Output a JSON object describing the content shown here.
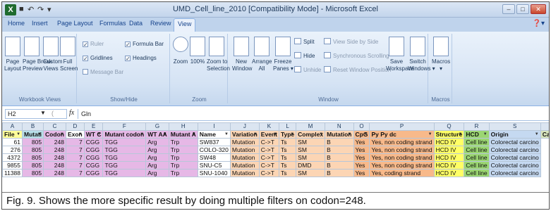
{
  "window": {
    "title": "UMD_Cell_line_2010 [Compatibility Mode] - Microsoft Excel",
    "app_icon": "excel-icon",
    "qat": [
      "save-icon",
      "undo-icon",
      "redo-icon",
      "customize-icon"
    ],
    "controls": [
      "minimize-icon",
      "restore-icon",
      "close-icon"
    ]
  },
  "ribbon_tabs": [
    "Home",
    "Insert",
    "Page Layout",
    "Formulas",
    "Data",
    "Review",
    "View"
  ],
  "active_tab": "View",
  "ribbon": {
    "workbook_views": {
      "label": "Workbook Views",
      "buttons": [
        "Page\nLayout",
        "Page Break\nPreview",
        "Custom\nViews",
        "Full\nScreen"
      ]
    },
    "show_hide": {
      "label": "Show/Hide",
      "checks": [
        {
          "label": "Ruler",
          "checked": true,
          "enabled": false
        },
        {
          "label": "Formula Bar",
          "checked": true,
          "enabled": true
        },
        {
          "label": "Gridlines",
          "checked": true,
          "enabled": true
        },
        {
          "label": "Headings",
          "checked": true,
          "enabled": true
        },
        {
          "label": "Message Bar",
          "checked": false,
          "enabled": false
        }
      ]
    },
    "zoom": {
      "label": "Zoom",
      "buttons": [
        "Zoom",
        "100%",
        "Zoom to\nSelection"
      ]
    },
    "window": {
      "label": "Window",
      "big_buttons": [
        "New\nWindow",
        "Arrange\nAll",
        "Freeze\nPanes ▾"
      ],
      "small_buttons": [
        {
          "label": "Split",
          "enabled": true
        },
        {
          "label": "Hide",
          "enabled": true
        },
        {
          "label": "Unhide",
          "enabled": false
        },
        {
          "label": "View Side by Side",
          "enabled": false
        },
        {
          "label": "Synchronous Scrolling",
          "enabled": false
        },
        {
          "label": "Reset Window Position",
          "enabled": false
        }
      ],
      "more_buttons": [
        "Save\nWorkspace",
        "Switch\nWindows ▾"
      ]
    },
    "macros": {
      "label": "Macros",
      "buttons": [
        "Macros\n▾"
      ]
    }
  },
  "formula_bar": {
    "name_box": "H2",
    "fx": "fx",
    "value": "Gln"
  },
  "column_letters": [
    "A",
    "B",
    "C",
    "D",
    "E",
    "F",
    "G",
    "H",
    "I",
    "J",
    "K",
    "L",
    "M",
    "N",
    "O",
    "P",
    "Q",
    "R",
    "S",
    "T"
  ],
  "headers": [
    "File",
    "Mutati",
    "Codon",
    "Exon",
    "WT C",
    "Mutant codon",
    "WT AA",
    "Mutant A",
    "Name",
    "Variation",
    "Event",
    "Type",
    "Complex",
    "Mutation",
    "CpG",
    "Py Py dc",
    "Structure",
    "HCD",
    "Origin",
    "Cancer"
  ],
  "rows": [
    [
      "61",
      "805",
      "248",
      "7",
      "CGG",
      "TGG",
      "Arg",
      "Trp",
      "SW837",
      "Mutation",
      "C->T",
      "Ts",
      "SM",
      "B",
      "Yes",
      "Yes, non coding strand",
      "HCD IV",
      "Cell line",
      "Colorectal carcino"
    ],
    [
      "276",
      "805",
      "248",
      "7",
      "CGG",
      "TGG",
      "Arg",
      "Trp",
      "COLO-320",
      "Mutation",
      "C->T",
      "Ts",
      "SM",
      "B",
      "Yes",
      "Yes, non coding strand",
      "HCD IV",
      "Cell line",
      "Colorectal carcino"
    ],
    [
      "4372",
      "805",
      "248",
      "7",
      "CGG",
      "TGG",
      "Arg",
      "Trp",
      "SW48",
      "Mutation",
      "C->T",
      "Ts",
      "SM",
      "B",
      "Yes",
      "Yes, non coding strand",
      "HCD IV",
      "Cell line",
      "Colorectal carcino"
    ],
    [
      "9855",
      "805",
      "248",
      "7",
      "CGG",
      "TGG",
      "Arg",
      "Trp",
      "SNU-C5",
      "Mutation",
      "C->T",
      "Ts",
      "DMD",
      "B",
      "Yes",
      "Yes, non coding strand",
      "HCD IV",
      "Cell line",
      "Colorectal carcino"
    ],
    [
      "11388",
      "805",
      "248",
      "7",
      "CGG",
      "TGG",
      "Arg",
      "Trp",
      "SNU-1040",
      "Mutation",
      "C->T",
      "Ts",
      "SM",
      "B",
      "Yes",
      "Yes, coding strand",
      "HCD IV",
      "Cell line",
      "Colorectal carcino"
    ]
  ],
  "caption": "Fig. 9. Shows the more specific result by doing multiple filters on codon=248."
}
